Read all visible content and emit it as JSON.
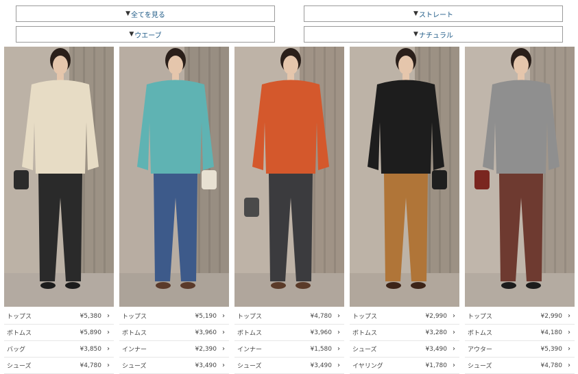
{
  "filters": [
    {
      "label": "全てを見る"
    },
    {
      "label": "ストレート"
    },
    {
      "label": "ウエーブ"
    },
    {
      "label": "ナチュラル"
    }
  ],
  "outfits": [
    {
      "colors": {
        "bg": "#bcb2a6",
        "curtain": "#8f8478",
        "floor": "#b3aaa1",
        "top": "#e7dcc5",
        "bottom": "#2a2a2a",
        "shoes": "#1c1c1c",
        "bag": "#2b2b2b"
      },
      "items": [
        {
          "category": "トップス",
          "price": "¥5,380"
        },
        {
          "category": "ボトムス",
          "price": "¥5,890"
        },
        {
          "category": "バッグ",
          "price": "¥3,850"
        },
        {
          "category": "シューズ",
          "price": "¥4,780"
        }
      ]
    },
    {
      "colors": {
        "bg": "#b8ada2",
        "curtain": "#8a8075",
        "floor": "#aca399",
        "top": "#5fb3b3",
        "bottom": "#3d5a8a",
        "shoes": "#5a3a2a",
        "bag": "#e8e1d2"
      },
      "items": [
        {
          "category": "トップス",
          "price": "¥5,190"
        },
        {
          "category": "ボトムス",
          "price": "¥3,960"
        },
        {
          "category": "インナー",
          "price": "¥2,390"
        },
        {
          "category": "シューズ",
          "price": "¥3,490"
        }
      ]
    },
    {
      "colors": {
        "bg": "#beb3a7",
        "curtain": "#938677",
        "floor": "#b0a69c",
        "top": "#d4582c",
        "bottom": "#3b3b3e",
        "shoes": "#5a3a28",
        "bag": "#4a4a4a"
      },
      "items": [
        {
          "category": "トップス",
          "price": "¥4,780"
        },
        {
          "category": "ボトムス",
          "price": "¥3,960"
        },
        {
          "category": "インナー",
          "price": "¥1,580"
        },
        {
          "category": "シューズ",
          "price": "¥3,490"
        }
      ]
    },
    {
      "colors": {
        "bg": "#bdb3a7",
        "curtain": "#8e8375",
        "floor": "#b1a79c",
        "top": "#1d1d1d",
        "bottom": "#b07538",
        "shoes": "#3c2418",
        "bag": "#1f1f1f"
      },
      "items": [
        {
          "category": "トップス",
          "price": "¥2,990"
        },
        {
          "category": "ボトムス",
          "price": "¥3,280"
        },
        {
          "category": "シューズ",
          "price": "¥3,490"
        },
        {
          "category": "イヤリング",
          "price": "¥1,780"
        }
      ]
    },
    {
      "colors": {
        "bg": "#c0b6ab",
        "curtain": "#958a7d",
        "floor": "#b4aba1",
        "top": "#8f8f8f",
        "bottom": "#6e3a30",
        "shoes": "#1c1c1c",
        "bag": "#7a2620"
      },
      "items": [
        {
          "category": "トップス",
          "price": "¥2,990"
        },
        {
          "category": "ボトムス",
          "price": "¥4,180"
        },
        {
          "category": "アウター",
          "price": "¥5,390"
        },
        {
          "category": "シューズ",
          "price": "¥4,780"
        }
      ]
    }
  ]
}
